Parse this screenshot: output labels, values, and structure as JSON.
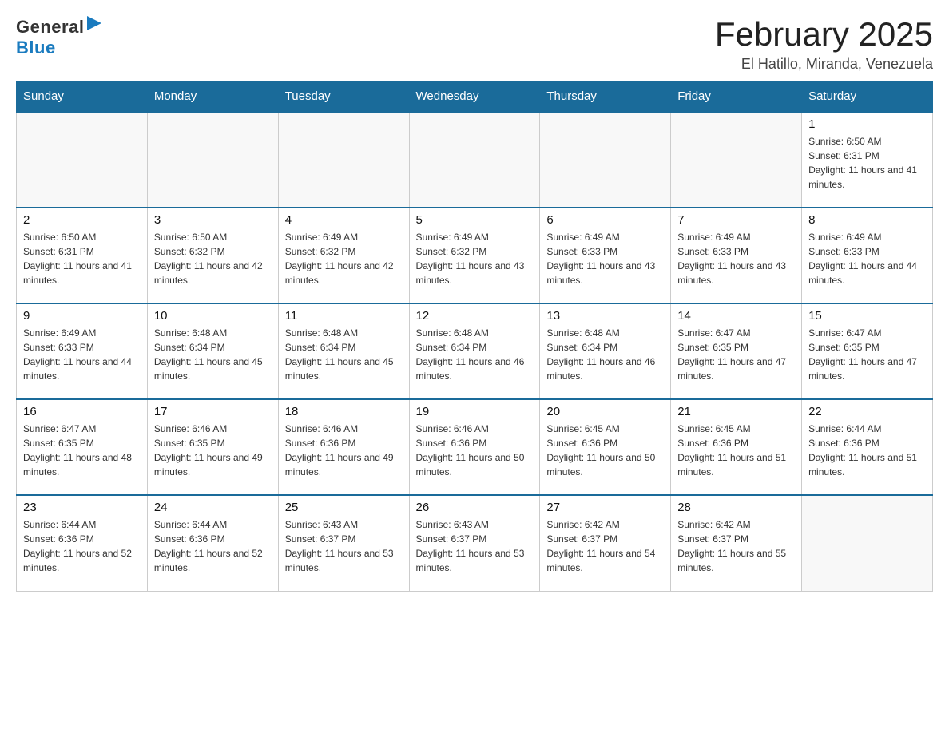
{
  "logo": {
    "general": "General",
    "blue": "Blue"
  },
  "title": "February 2025",
  "location": "El Hatillo, Miranda, Venezuela",
  "days_of_week": [
    "Sunday",
    "Monday",
    "Tuesday",
    "Wednesday",
    "Thursday",
    "Friday",
    "Saturday"
  ],
  "weeks": [
    [
      {
        "day": "",
        "info": ""
      },
      {
        "day": "",
        "info": ""
      },
      {
        "day": "",
        "info": ""
      },
      {
        "day": "",
        "info": ""
      },
      {
        "day": "",
        "info": ""
      },
      {
        "day": "",
        "info": ""
      },
      {
        "day": "1",
        "info": "Sunrise: 6:50 AM\nSunset: 6:31 PM\nDaylight: 11 hours and 41 minutes."
      }
    ],
    [
      {
        "day": "2",
        "info": "Sunrise: 6:50 AM\nSunset: 6:31 PM\nDaylight: 11 hours and 41 minutes."
      },
      {
        "day": "3",
        "info": "Sunrise: 6:50 AM\nSunset: 6:32 PM\nDaylight: 11 hours and 42 minutes."
      },
      {
        "day": "4",
        "info": "Sunrise: 6:49 AM\nSunset: 6:32 PM\nDaylight: 11 hours and 42 minutes."
      },
      {
        "day": "5",
        "info": "Sunrise: 6:49 AM\nSunset: 6:32 PM\nDaylight: 11 hours and 43 minutes."
      },
      {
        "day": "6",
        "info": "Sunrise: 6:49 AM\nSunset: 6:33 PM\nDaylight: 11 hours and 43 minutes."
      },
      {
        "day": "7",
        "info": "Sunrise: 6:49 AM\nSunset: 6:33 PM\nDaylight: 11 hours and 43 minutes."
      },
      {
        "day": "8",
        "info": "Sunrise: 6:49 AM\nSunset: 6:33 PM\nDaylight: 11 hours and 44 minutes."
      }
    ],
    [
      {
        "day": "9",
        "info": "Sunrise: 6:49 AM\nSunset: 6:33 PM\nDaylight: 11 hours and 44 minutes."
      },
      {
        "day": "10",
        "info": "Sunrise: 6:48 AM\nSunset: 6:34 PM\nDaylight: 11 hours and 45 minutes."
      },
      {
        "day": "11",
        "info": "Sunrise: 6:48 AM\nSunset: 6:34 PM\nDaylight: 11 hours and 45 minutes."
      },
      {
        "day": "12",
        "info": "Sunrise: 6:48 AM\nSunset: 6:34 PM\nDaylight: 11 hours and 46 minutes."
      },
      {
        "day": "13",
        "info": "Sunrise: 6:48 AM\nSunset: 6:34 PM\nDaylight: 11 hours and 46 minutes."
      },
      {
        "day": "14",
        "info": "Sunrise: 6:47 AM\nSunset: 6:35 PM\nDaylight: 11 hours and 47 minutes."
      },
      {
        "day": "15",
        "info": "Sunrise: 6:47 AM\nSunset: 6:35 PM\nDaylight: 11 hours and 47 minutes."
      }
    ],
    [
      {
        "day": "16",
        "info": "Sunrise: 6:47 AM\nSunset: 6:35 PM\nDaylight: 11 hours and 48 minutes."
      },
      {
        "day": "17",
        "info": "Sunrise: 6:46 AM\nSunset: 6:35 PM\nDaylight: 11 hours and 49 minutes."
      },
      {
        "day": "18",
        "info": "Sunrise: 6:46 AM\nSunset: 6:36 PM\nDaylight: 11 hours and 49 minutes."
      },
      {
        "day": "19",
        "info": "Sunrise: 6:46 AM\nSunset: 6:36 PM\nDaylight: 11 hours and 50 minutes."
      },
      {
        "day": "20",
        "info": "Sunrise: 6:45 AM\nSunset: 6:36 PM\nDaylight: 11 hours and 50 minutes."
      },
      {
        "day": "21",
        "info": "Sunrise: 6:45 AM\nSunset: 6:36 PM\nDaylight: 11 hours and 51 minutes."
      },
      {
        "day": "22",
        "info": "Sunrise: 6:44 AM\nSunset: 6:36 PM\nDaylight: 11 hours and 51 minutes."
      }
    ],
    [
      {
        "day": "23",
        "info": "Sunrise: 6:44 AM\nSunset: 6:36 PM\nDaylight: 11 hours and 52 minutes."
      },
      {
        "day": "24",
        "info": "Sunrise: 6:44 AM\nSunset: 6:36 PM\nDaylight: 11 hours and 52 minutes."
      },
      {
        "day": "25",
        "info": "Sunrise: 6:43 AM\nSunset: 6:37 PM\nDaylight: 11 hours and 53 minutes."
      },
      {
        "day": "26",
        "info": "Sunrise: 6:43 AM\nSunset: 6:37 PM\nDaylight: 11 hours and 53 minutes."
      },
      {
        "day": "27",
        "info": "Sunrise: 6:42 AM\nSunset: 6:37 PM\nDaylight: 11 hours and 54 minutes."
      },
      {
        "day": "28",
        "info": "Sunrise: 6:42 AM\nSunset: 6:37 PM\nDaylight: 11 hours and 55 minutes."
      },
      {
        "day": "",
        "info": ""
      }
    ]
  ]
}
